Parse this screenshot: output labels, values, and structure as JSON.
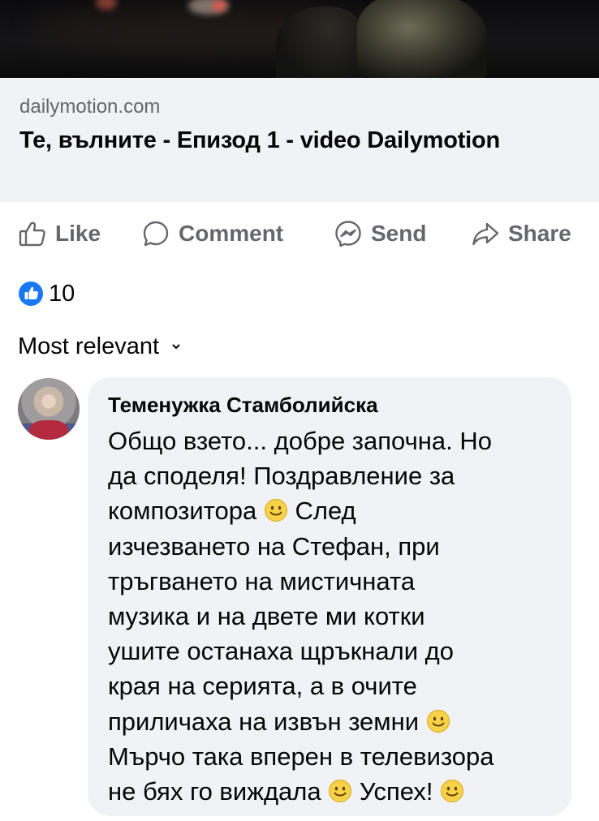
{
  "link_preview": {
    "domain": "dailymotion.com",
    "title": "Те, вълните - Епизод 1 - video Dailymotion"
  },
  "actions": {
    "like": "Like",
    "comment": "Comment",
    "send": "Send",
    "share": "Share"
  },
  "reactions": {
    "icon": "like-reaction-icon",
    "count": "10"
  },
  "sort": {
    "label": "Most relevant"
  },
  "comment": {
    "author": "Теменужка Стамболийска",
    "lines": [
      "Общо взето... добре започна. Но",
      "да споделя! Поздравление за",
      "композитора ",
      " След",
      "изчезването на Стефан, при",
      "тръгването на мистичната",
      "музика и на двете ми котки",
      "ушите останаха щръкнали до",
      "края на серията, а в очите",
      "приличаха на извън земни ",
      "Мърчо така вперен в телевизора",
      "не бях го виждала ",
      " Успех! "
    ]
  },
  "colors": {
    "accent": "#1877f2",
    "muted": "#65676b",
    "bubble": "#f0f2f5",
    "emoji": "#f7d146"
  }
}
